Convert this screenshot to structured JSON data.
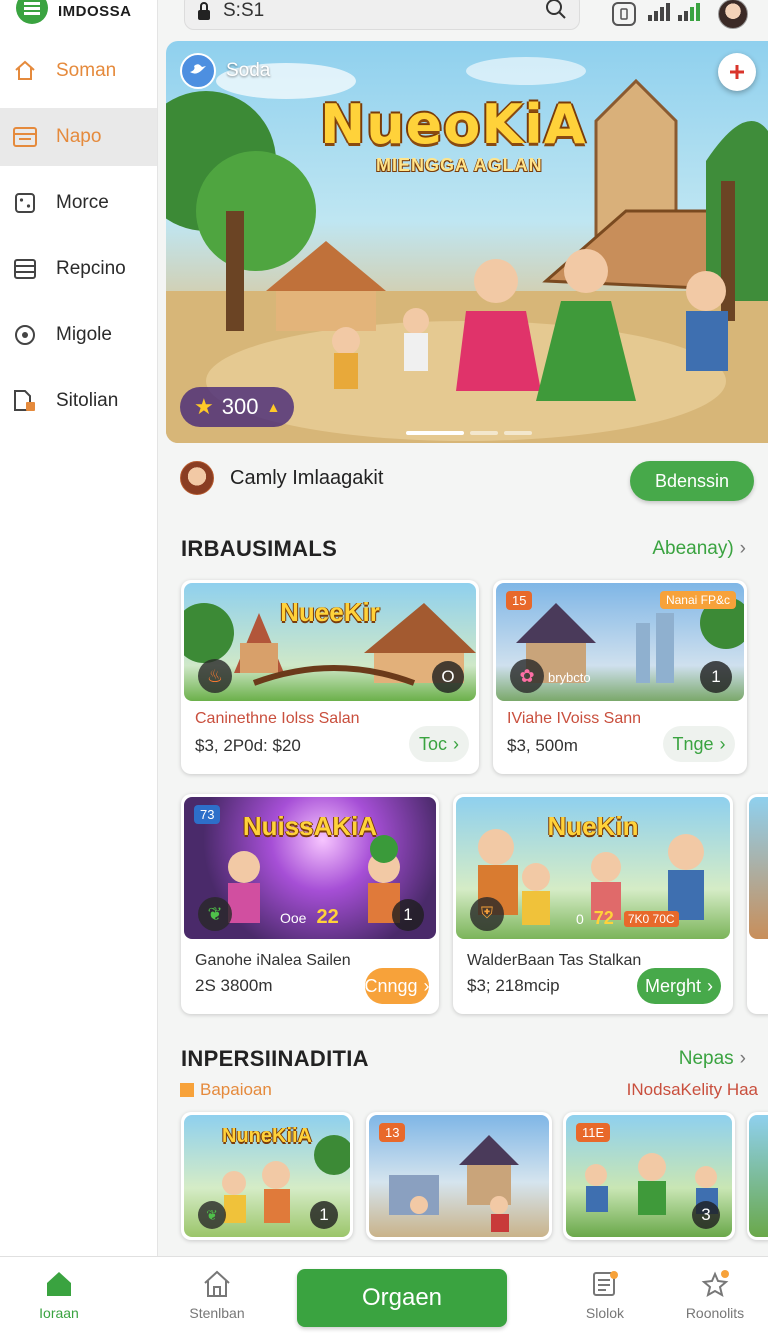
{
  "app": {
    "brand_name": "IMDOSSA"
  },
  "search": {
    "value": "S:S1"
  },
  "status": {
    "icons": [
      "badge-icon",
      "signal-icon",
      "avatar"
    ]
  },
  "sidebar": {
    "items": [
      {
        "label": "Soman",
        "icon": "home-icon"
      },
      {
        "label": "Napo",
        "icon": "calendar-icon"
      },
      {
        "label": "Morce",
        "icon": "dice-icon"
      },
      {
        "label": "Repcino",
        "icon": "list-icon"
      },
      {
        "label": "Migole",
        "icon": "target-icon"
      },
      {
        "label": "Sitolian",
        "icon": "document-icon"
      }
    ]
  },
  "hero": {
    "tag": "Soda",
    "title": "NueoKiA",
    "subtitle": "MIENGGA AGLAN",
    "coins": "300",
    "slide_count": 3,
    "active_slide": 0
  },
  "account": {
    "name": "Camly Imlaagakit",
    "button": "Bdenssin"
  },
  "section1": {
    "title": "IRBAUSIMALS",
    "link": "Abeanay)",
    "cards": [
      {
        "art": "NueeKir",
        "name": "Caninethne Iolss Salan",
        "price": "$3, 2P0d: $20",
        "count": "O",
        "action": "Toc"
      },
      {
        "art": "",
        "badge": "15",
        "corner": "Nanai FP&c",
        "label": "brybcto",
        "name": "IViahe IVoiss Sann",
        "price": "$3, 500m",
        "count": "1",
        "action": "Tnge"
      },
      {
        "art": "NuissAKiA",
        "badge": "73",
        "overlay": "Ooe",
        "overlay_num": "22",
        "name": "Ganohe iNalea Sailen",
        "price": "2S 3800m",
        "count": "1",
        "action": "Cnngg"
      },
      {
        "art": "NueKin",
        "overlay": "0",
        "overlay_num": "72",
        "overlay_tag": "7K0 70C",
        "name": "WalderBaan Tas Stalkan",
        "price": "$3; 218mcip",
        "action": "Merght"
      }
    ]
  },
  "section2": {
    "title": "INPERSIINADITIA",
    "link": "Nepas",
    "sub_left": "Bapaioan",
    "sub_right": "INodsaKelity Haa",
    "cards": [
      {
        "art": "NuneKiiA",
        "count": "1"
      },
      {
        "art": "",
        "badge": "13"
      },
      {
        "art": "",
        "badge": "11E",
        "count": "3"
      }
    ]
  },
  "bottom_nav": {
    "items": [
      {
        "label": "Ioraan",
        "icon": "home-icon"
      },
      {
        "label": "Stenlban",
        "icon": "house-outline-icon"
      },
      {
        "label": "Slolok",
        "icon": "news-icon"
      },
      {
        "label": "Roonolits",
        "icon": "star-badge-icon"
      }
    ],
    "cta": "Orgaen"
  },
  "colors": {
    "accent": "#3aa340",
    "orange": "#e58a3c",
    "hero_title": "#ffd23a"
  }
}
